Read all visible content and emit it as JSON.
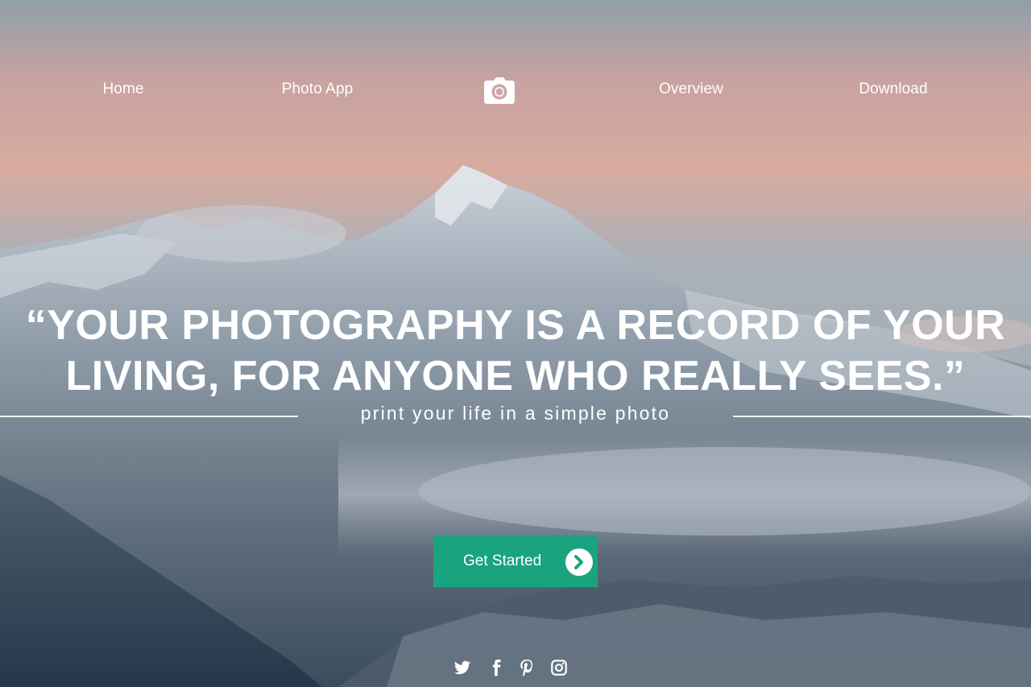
{
  "nav": {
    "items": [
      {
        "label": "Home"
      },
      {
        "label": "Photo App"
      },
      {
        "label": "Overview"
      },
      {
        "label": "Download"
      }
    ],
    "logo_icon": "camera-icon"
  },
  "hero": {
    "quote_line1": "“YOUR PHOTOGRAPHY IS A RECORD OF YOUR",
    "quote_line2": "LIVING, FOR ANYONE WHO REALLY SEES.”",
    "tagline": "print your life in a simple photo",
    "cta_label": "Get Started",
    "cta_icon": "chevron-right-circle-icon",
    "cta_color": "#1aa37f"
  },
  "social": [
    {
      "icon": "twitter-icon"
    },
    {
      "icon": "facebook-icon"
    },
    {
      "icon": "pinterest-icon"
    },
    {
      "icon": "instagram-icon"
    }
  ]
}
